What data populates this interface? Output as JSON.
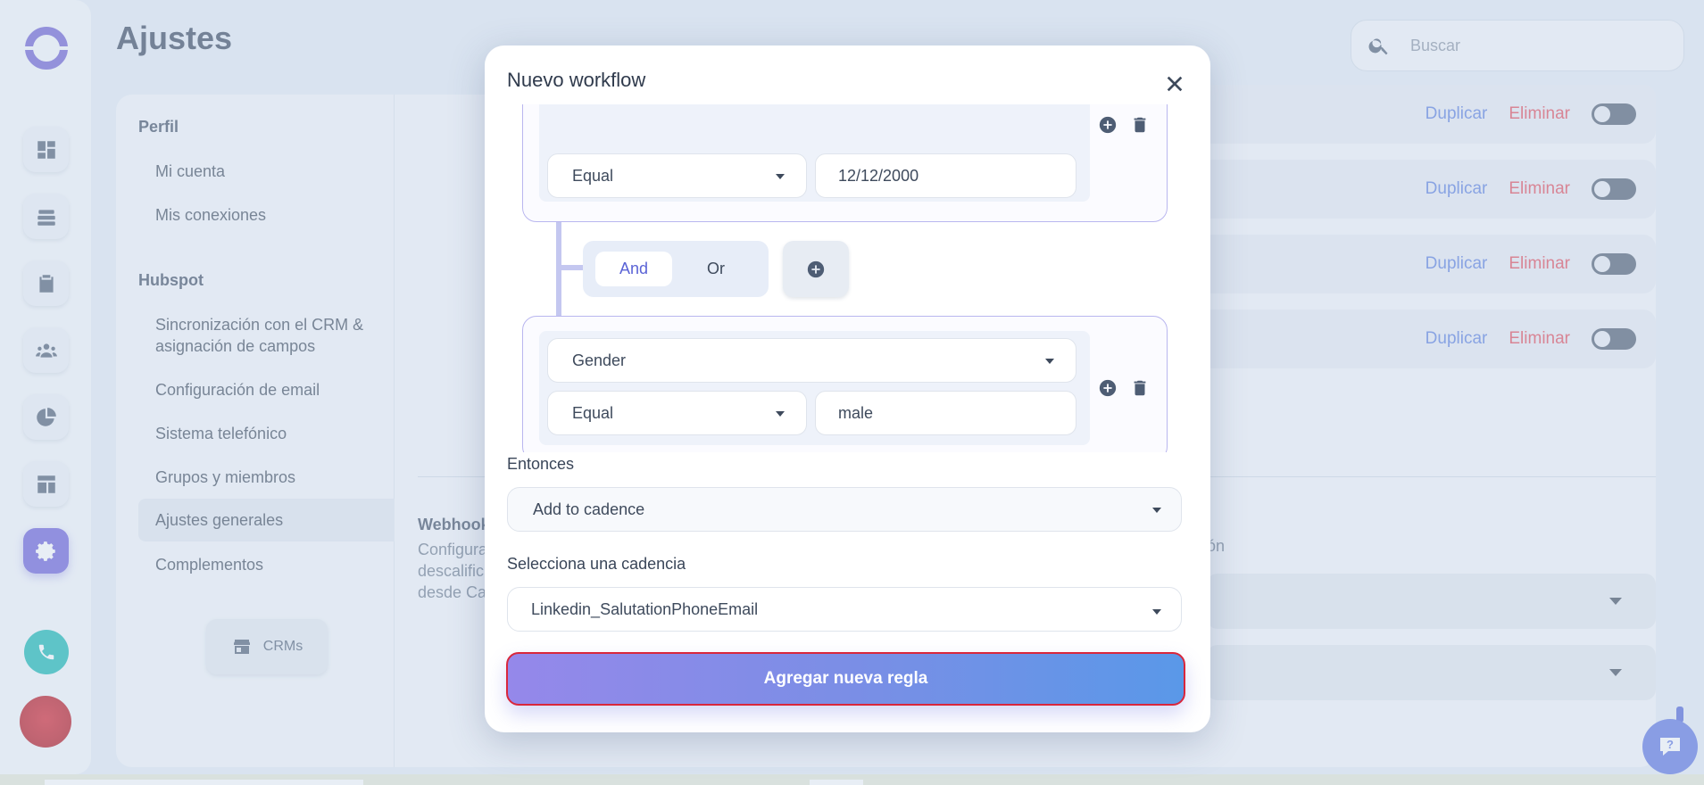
{
  "page": {
    "title": "Ajustes"
  },
  "search": {
    "placeholder": "Buscar"
  },
  "subnav": {
    "perfil_header": "Perfil",
    "perfil_items": [
      "Mi cuenta",
      "Mis conexiones"
    ],
    "hubspot_header": "Hubspot",
    "hubspot_items": [
      "Sincronización con el CRM & asignación de campos",
      "Configuración de email",
      "Sistema telefónico",
      "Grupos y miembros",
      "Ajustes generales",
      "Complementos"
    ],
    "crm_button": "CRMs"
  },
  "rules": {
    "duplicate_label": "Duplicar",
    "delete_label": "Eliminar"
  },
  "webhook": {
    "title": "Webhook",
    "desc_lines": [
      "Configura",
      "descalific",
      "desde Ca"
    ],
    "desc_tail": "ón"
  },
  "modal": {
    "title": "Nuevo workflow",
    "condition1": {
      "operator": "Equal",
      "value": "12/12/2000"
    },
    "logic": {
      "and_label": "And",
      "or_label": "Or"
    },
    "condition2": {
      "field": "Gender",
      "operator": "Equal",
      "value": "male"
    },
    "then_label": "Entonces",
    "then_value": "Add to cadence",
    "cadence_label": "Selecciona una cadencia",
    "cadence_value": "Linkedin_SalutationPhoneEmail",
    "submit_label": "Agregar nueva regla"
  },
  "colors": {
    "accent": "#6a5ed9",
    "delete": "#e34a5a",
    "duplicate": "#5b7fe0",
    "phone": "#12b7b2"
  }
}
